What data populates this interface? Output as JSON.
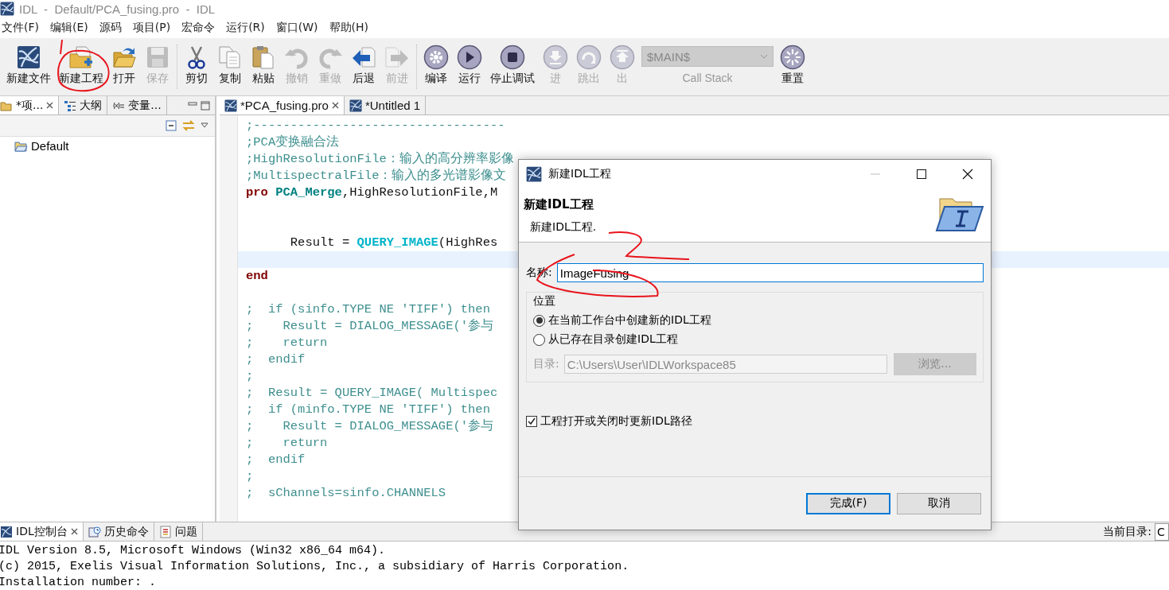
{
  "window": {
    "title": "IDL  -  Default/PCA_fusing.pro  -  IDL"
  },
  "menu": [
    "文件(F)",
    "编辑(E)",
    "源码",
    "项目(P)",
    "宏命令",
    "运行(R)",
    "窗口(W)",
    "帮助(H)"
  ],
  "toolbar": {
    "groups": [
      {
        "items": [
          {
            "label": "新建文件",
            "kind": "logo",
            "disabled": false
          },
          {
            "label": "新建工程",
            "kind": "newproject",
            "disabled": false
          },
          {
            "label": "打开",
            "kind": "open",
            "disabled": false
          },
          {
            "label": "保存",
            "kind": "save",
            "disabled": true
          }
        ]
      },
      {
        "items": [
          {
            "label": "剪切",
            "kind": "cut",
            "disabled": false
          },
          {
            "label": "复制",
            "kind": "copy",
            "disabled": false
          },
          {
            "label": "粘贴",
            "kind": "paste",
            "disabled": false
          },
          {
            "label": "撤销",
            "kind": "undo",
            "disabled": true
          },
          {
            "label": "重做",
            "kind": "redo",
            "disabled": true
          },
          {
            "label": "后退",
            "kind": "back",
            "disabled": false
          },
          {
            "label": "前进",
            "kind": "forward",
            "disabled": true
          }
        ]
      },
      {
        "items": [
          {
            "label": "编译",
            "kind": "gear",
            "disabled": false
          },
          {
            "label": "运行",
            "kind": "play",
            "disabled": false
          },
          {
            "label": "停止调试",
            "kind": "stop",
            "disabled": false
          },
          {
            "label": "进",
            "kind": "stepinto",
            "disabled": true
          },
          {
            "label": "跳出",
            "kind": "stepover",
            "disabled": true
          },
          {
            "label": "出",
            "kind": "stepout",
            "disabled": true
          },
          {
            "label": "Call Stack",
            "kind": "combo",
            "value": "$MAIN$",
            "disabled": true
          },
          {
            "label": "重置",
            "kind": "reset",
            "disabled": false
          }
        ]
      }
    ]
  },
  "left_panel": {
    "tabs": [
      {
        "label": "*项...",
        "kind": "project",
        "selected": true,
        "closable": true
      },
      {
        "label": "大纲",
        "kind": "outline",
        "selected": false,
        "closable": false
      },
      {
        "label": "变量...",
        "kind": "variables",
        "selected": false,
        "closable": false
      }
    ],
    "tree": [
      {
        "label": "Default"
      }
    ]
  },
  "editor": {
    "tabs": [
      {
        "label": "*PCA_fusing.pro",
        "selected": true,
        "closable": true
      },
      {
        "label": "*Untitled 1",
        "selected": false,
        "closable": false
      }
    ],
    "lines": [
      {
        "current": false,
        "tokens": [
          {
            "text": ";----------------------------------",
            "kind": "comment"
          }
        ]
      },
      {
        "current": false,
        "tokens": [
          {
            "text": ";PCA变换融合法",
            "kind": "comment"
          }
        ]
      },
      {
        "current": false,
        "tokens": [
          {
            "text": ";HighResolutionFile：输入的高分辨率影像",
            "kind": "comment"
          }
        ]
      },
      {
        "current": false,
        "tokens": [
          {
            "text": ";MultispectralFile：输入的多光谱影像文",
            "kind": "comment"
          }
        ]
      },
      {
        "current": false,
        "tokens": [
          {
            "text": "pro",
            "kind": "keyword"
          },
          {
            "text": " PCA_Merge",
            "kind": "name"
          },
          {
            "text": ",HighResolutionFile,M",
            "kind": "plain"
          }
        ]
      },
      {
        "current": false
      },
      {
        "current": false
      },
      {
        "current": false,
        "tokens": [
          {
            "text": "      Result = ",
            "kind": "plain"
          },
          {
            "text": "QUERY_IMAGE",
            "kind": "builtin"
          },
          {
            "text": "(HighRes",
            "kind": "plain"
          }
        ]
      },
      {
        "current": true
      },
      {
        "current": false,
        "tokens": [
          {
            "text": "end",
            "kind": "keyword"
          }
        ]
      },
      {
        "current": false
      },
      {
        "current": false,
        "tokens": [
          {
            "text": ";  if (sinfo.TYPE NE 'TIFF') then",
            "kind": "comment"
          }
        ]
      },
      {
        "current": false,
        "tokens": [
          {
            "text": ";    Result = DIALOG_MESSAGE('参与",
            "kind": "comment"
          }
        ]
      },
      {
        "current": false,
        "tokens": [
          {
            "text": ";    return",
            "kind": "comment"
          }
        ]
      },
      {
        "current": false,
        "tokens": [
          {
            "text": ";  endif",
            "kind": "comment"
          }
        ]
      },
      {
        "current": false,
        "tokens": [
          {
            "text": ";",
            "kind": "comment"
          }
        ]
      },
      {
        "current": false,
        "tokens": [
          {
            "text": ";  Result = QUERY_IMAGE( Multispec",
            "kind": "comment"
          }
        ]
      },
      {
        "current": false,
        "tokens": [
          {
            "text": ";  if (minfo.TYPE NE 'TIFF') then",
            "kind": "comment"
          }
        ]
      },
      {
        "current": false,
        "tokens": [
          {
            "text": ";    Result = DIALOG_MESSAGE('参与",
            "kind": "comment"
          }
        ]
      },
      {
        "current": false,
        "tokens": [
          {
            "text": ";    return",
            "kind": "comment"
          }
        ]
      },
      {
        "current": false,
        "tokens": [
          {
            "text": ";  endif",
            "kind": "comment"
          }
        ]
      },
      {
        "current": false,
        "tokens": [
          {
            "text": ";",
            "kind": "comment"
          }
        ]
      },
      {
        "current": false,
        "tokens": [
          {
            "text": ";  sChannels=sinfo.CHANNELS",
            "kind": "comment"
          }
        ]
      }
    ]
  },
  "console": {
    "tabs": [
      {
        "label": "IDL控制台",
        "kind": "console",
        "selected": true,
        "closable": true
      },
      {
        "label": "历史命令",
        "kind": "history",
        "selected": false,
        "closable": false
      },
      {
        "label": "问题",
        "kind": "problems",
        "selected": false,
        "closable": false
      }
    ],
    "current_dir": {
      "label": "当前目录:",
      "value": "C"
    },
    "lines": [
      "IDL Version 8.5, Microsoft Windows (Win32 x86_64 m64).",
      "(c) 2015, Exelis Visual Information Solutions, Inc., a subsidiary of Harris Corporation.",
      "Installation number: ."
    ]
  },
  "dialog": {
    "title": "新建IDL工程",
    "heading": "新建IDL工程",
    "description": "新建IDL工程.",
    "name_label": "名称:",
    "name_value": "ImageFusing",
    "location": {
      "legend": "位置",
      "options": [
        {
          "label": "在当前工作台中创建新的IDL工程",
          "selected": true
        },
        {
          "label": "从已存在目录创建IDL工程",
          "selected": false
        }
      ],
      "dir_label": "目录:",
      "dir_value": "C:\\Users\\User\\IDLWorkspace85",
      "browse": "浏览...",
      "disabled": true
    },
    "update_path": {
      "label": "工程打开或关闭时更新IDL路径",
      "checked": true
    },
    "buttons": [
      {
        "label": "完成(F)",
        "default": true
      },
      {
        "label": "取消",
        "default": false
      }
    ]
  }
}
